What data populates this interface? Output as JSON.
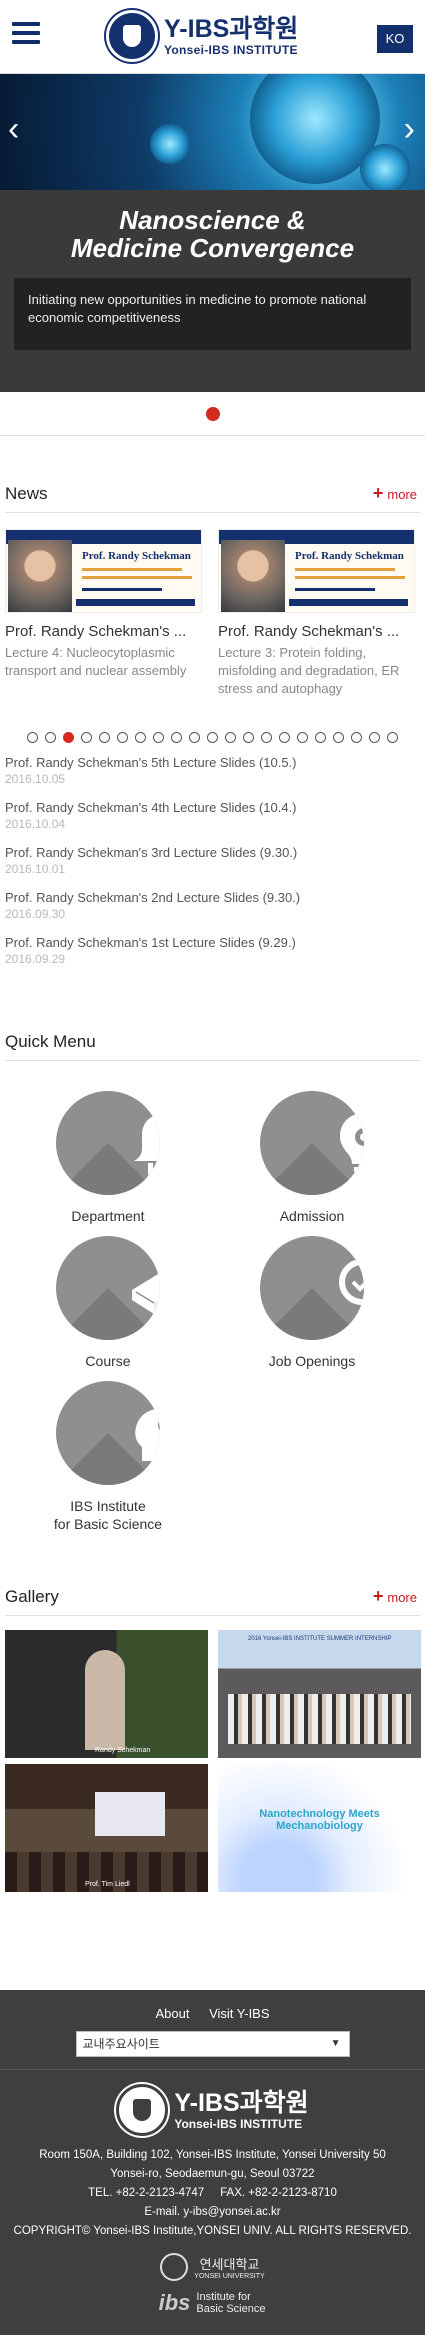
{
  "header": {
    "logo_title": "Y-IBS과학원",
    "logo_sub": "Yonsei-IBS INSTITUTE",
    "lang": "KO"
  },
  "hero": {
    "title_line1": "Nanoscience &",
    "title_line2": "Medicine Convergence",
    "description": "Initiating new opportunities in medicine to promote national economic competitiveness",
    "prev": "‹",
    "next": "›"
  },
  "news": {
    "title": "News",
    "more": "more",
    "cards": [
      {
        "title": "Prof. Randy Schekman's ...",
        "desc": "Lecture 4: Nucleocytoplasmic transport and nuclear assembly",
        "img_title": "Prof. Randy Schekman"
      },
      {
        "title": "Prof. Randy Schekman's ...",
        "desc": "Lecture 3: Protein folding, misfolding and degradation, ER stress and autophagy",
        "img_title": "Prof. Randy Schekman"
      }
    ],
    "items": [
      {
        "title": "Prof. Randy Schekman's 5th Lecture Slides (10.5.)",
        "date": "2016.10.05"
      },
      {
        "title": "Prof. Randy Schekman's 4th Lecture Slides (10.4.)",
        "date": "2016.10.04"
      },
      {
        "title": "Prof. Randy Schekman's 3rd Lecture Slides (9.30.)",
        "date": "2016.10.01"
      },
      {
        "title": "Prof. Randy Schekman's 2nd Lecture Slides (9.30.)",
        "date": "2016.09.30"
      },
      {
        "title": "Prof. Randy Schekman's 1st Lecture Slides (9.29.)",
        "date": "2016.09.29"
      }
    ]
  },
  "quick_menu": {
    "title": "Quick Menu",
    "items": [
      {
        "label": "Department",
        "icon": "bell-icon"
      },
      {
        "label": "Admission",
        "icon": "lightbulb-gear-icon"
      },
      {
        "label": "Course",
        "icon": "book-icon"
      },
      {
        "label": "Job Openings",
        "icon": "magnifier-check-icon"
      },
      {
        "label": "IBS Institute\nfor Basic Science",
        "icon": "head-bulb-icon"
      }
    ]
  },
  "gallery": {
    "title": "Gallery",
    "more": "more",
    "captions": [
      "Randy Schekman",
      "2016 Yonsei-IBS INSTITUTE SUMMER INTERNSHIP",
      "Prof. Tim Liedl",
      "Nanotechnology Meets Mechanobiology"
    ]
  },
  "footer": {
    "link_about": "About",
    "link_visit": "Visit Y-IBS",
    "select_value": "교내주요사이트",
    "logo_title": "Y-IBS과학원",
    "logo_sub": "Yonsei-IBS INSTITUTE",
    "address1": "Room 150A, Building 102, Yonsei-IBS Institute, Yonsei University 50",
    "address2": "Yonsei-ro, Seodaemun-gu, Seoul 03722",
    "phone": "TEL. +82-2-2123-4747     FAX. +82-2-2123-8710",
    "email": "E-mail. y-ibs@yonsei.ac.kr",
    "copyright": "COPYRIGHT© Yonsei-IBS Institute,YONSEI UNIV. ALL RIGHTS RESERVED.",
    "partner1": "연세대학교",
    "partner1_sub": "YONSEI UNIVERSITY",
    "partner2": "Institute for Basic Science"
  }
}
